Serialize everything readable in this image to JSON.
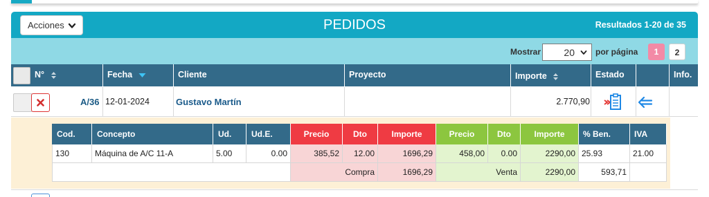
{
  "header": {
    "actions_label": "Acciones",
    "title": "PEDIDOS",
    "results": "Resultados 1-20 de 35"
  },
  "toolbar": {
    "show_label": "Mostrar",
    "per_page_value": "20",
    "per_page_suffix": "por página",
    "pages": [
      "1",
      "2"
    ],
    "current_page": "1"
  },
  "columns": {
    "num": "N°",
    "fecha": "Fecha",
    "cliente": "Cliente",
    "proyecto": "Proyecto",
    "importe": "Importe",
    "estado": "Estado",
    "info": "Info."
  },
  "row": {
    "num": "A/36",
    "fecha": "12-01-2024",
    "cliente": "Gustavo Martín",
    "proyecto": "",
    "importe": "2.770,90"
  },
  "detail": {
    "headers": {
      "cod": "Cod.",
      "concepto": "Concepto",
      "ud": "Ud.",
      "ude": "Ud.E.",
      "precio_compra": "Precio",
      "dto_compra": "Dto",
      "importe_compra": "Importe",
      "precio_venta": "Precio",
      "dto_venta": "Dto",
      "importe_venta": "Importe",
      "ben": "% Ben.",
      "iva": "IVA"
    },
    "line": {
      "cod": "130",
      "concepto": "Máquina de A/C 11-A",
      "ud": "5.00",
      "ude": "0.00",
      "precio_compra": "385,52",
      "dto_compra": "12.00",
      "importe_compra": "1696,29",
      "precio_venta": "458,00",
      "dto_venta": "0.00",
      "importe_venta": "2290,00",
      "ben": "25.93",
      "iva": "21.00"
    },
    "totals": {
      "compra_label": "Compra",
      "compra_value": "1696,29",
      "venta_label": "Venta",
      "venta_value": "2290,00",
      "beneficio": "593,71"
    }
  },
  "colors": {
    "header_bg": "#13a8c4",
    "subbar_bg": "#8fd9e5",
    "table_header": "#336a89",
    "purchase_header": "#ef3b43",
    "sale_header": "#8cc63f",
    "active_page": "#f38aa6"
  },
  "icons": {
    "actions": "chevron-down-icon",
    "sort_num": "sort-icon",
    "sort_fecha": "sort-desc-icon",
    "sort_importe": "sort-icon",
    "delete": "close-icon",
    "estado": "clipboard-icon",
    "back": "arrow-left-icon"
  }
}
